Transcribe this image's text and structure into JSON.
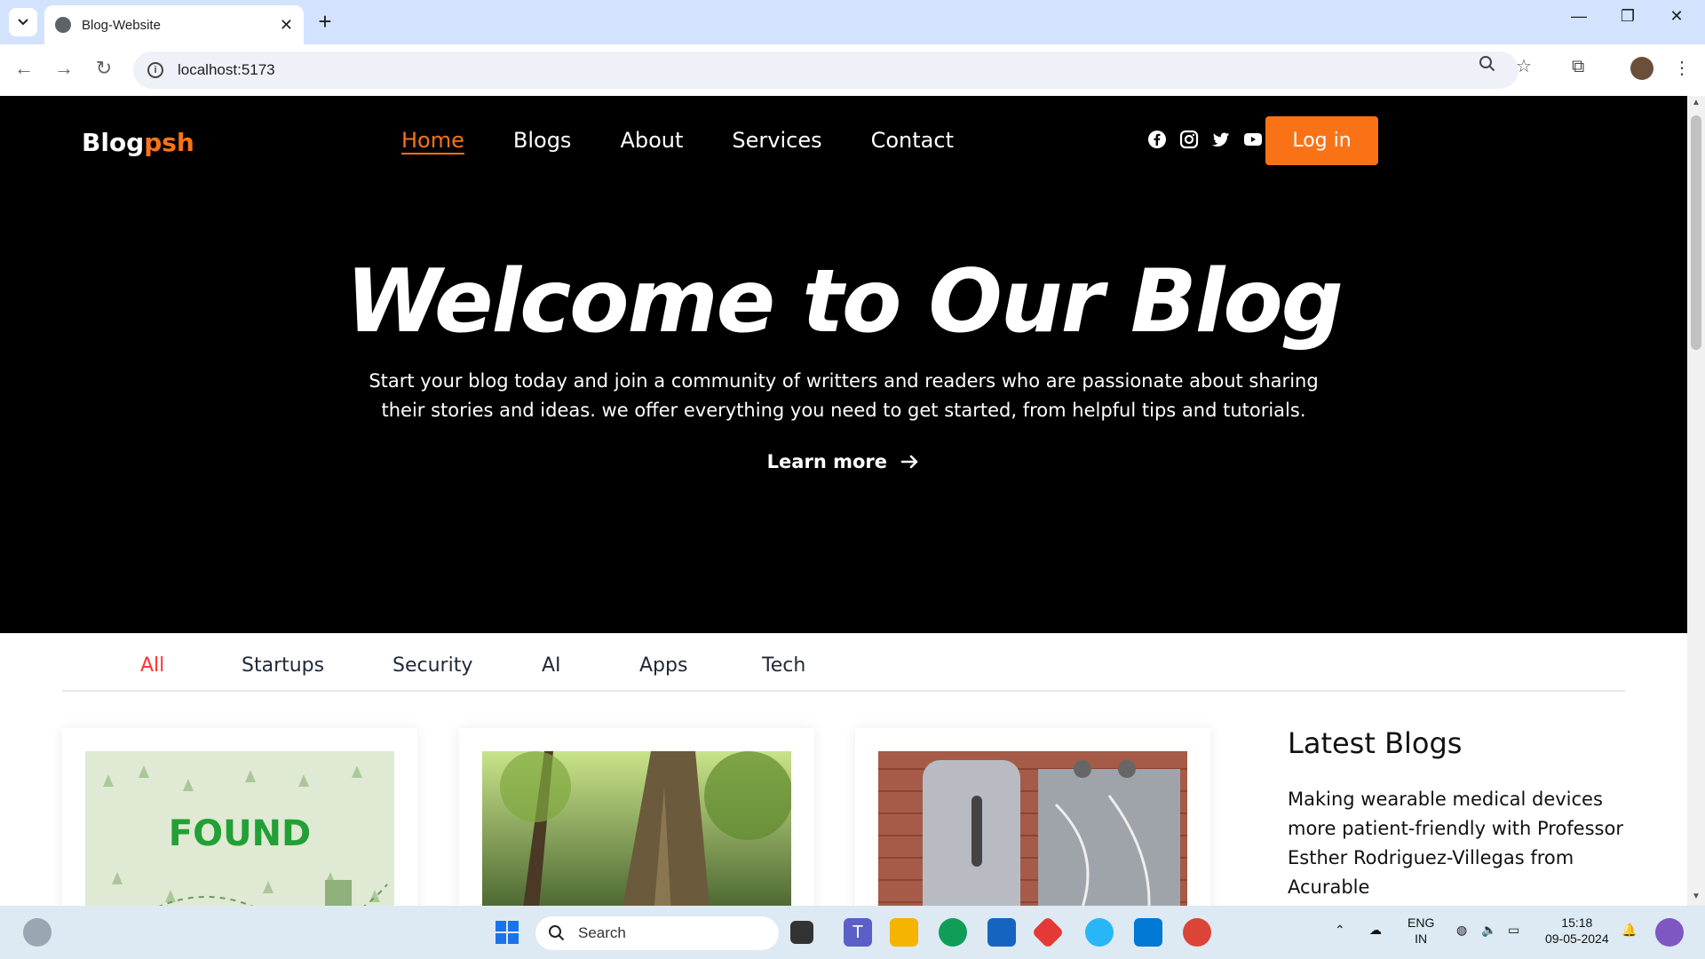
{
  "browser": {
    "tab_title": "Blog-Website",
    "url": "localhost:5173"
  },
  "site": {
    "logo_main": "Blog",
    "logo_accent": "psh",
    "nav": [
      "Home",
      "Blogs",
      "About",
      "Services",
      "Contact"
    ],
    "login_label": "Log in"
  },
  "hero": {
    "title": "Welcome to Our Blog",
    "subtitle": "Start your blog today and join a community of writters and readers who are passionate about sharing their stories and ideas. we offer everything you need to get started, from helpful tips and tutorials.",
    "cta": "Learn more"
  },
  "categories": [
    "All",
    "Startups",
    "Security",
    "AI",
    "Apps",
    "Tech"
  ],
  "cards": [
    {
      "image": "found-illustration",
      "image_text": "FOUND"
    },
    {
      "image": "forest-photo"
    },
    {
      "image": "lab-equipment-photo"
    }
  ],
  "latest": {
    "heading": "Latest Blogs",
    "first_title": "Making wearable medical devices more patient-friendly with Professor Esther Rodriguez-Villegas from Acurable"
  },
  "taskbar": {
    "search_placeholder": "Search",
    "lang_line1": "ENG",
    "lang_line2": "IN",
    "time": "15:18",
    "date": "09-05-2024"
  },
  "colors": {
    "accent": "#f97316",
    "active_category": "#ff3333",
    "hero_bg": "#000000"
  }
}
